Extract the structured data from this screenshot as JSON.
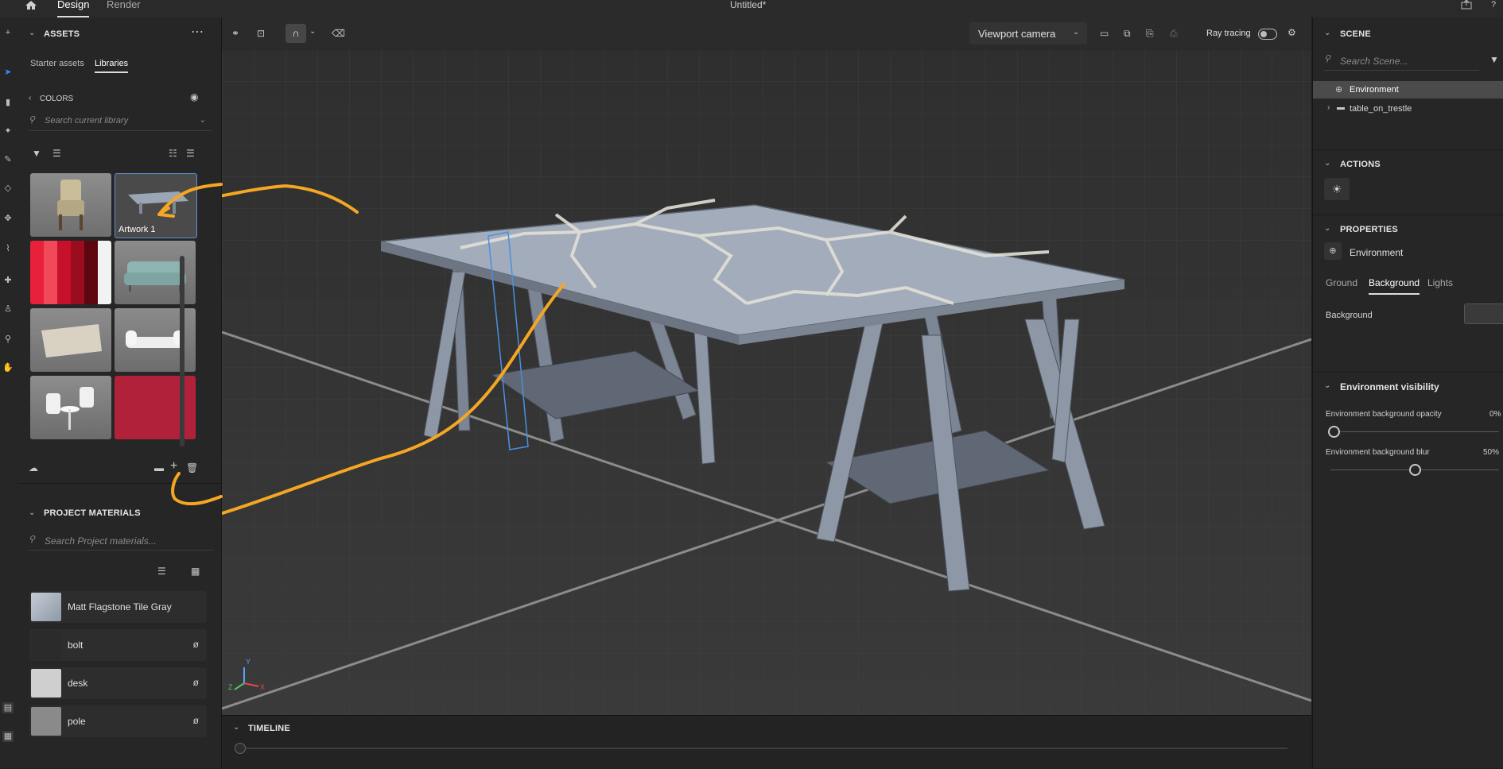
{
  "topbar": {
    "tabs": [
      "Design",
      "Render"
    ],
    "document_title": "Untitled*"
  },
  "assets": {
    "title": "ASSETS",
    "subtabs": [
      "Starter assets",
      "Libraries"
    ],
    "active_subtab": "Libraries",
    "library_back_label": "COLORS",
    "search_placeholder": "Search current library",
    "thumbs": [
      {
        "name": "armchair-thumb",
        "label": ""
      },
      {
        "name": "artwork-thumb",
        "label": "Artwork 1"
      },
      {
        "name": "red-palette-thumb",
        "label": ""
      },
      {
        "name": "sofa-thumb",
        "label": ""
      },
      {
        "name": "pouch-thumb",
        "label": ""
      },
      {
        "name": "daybed-thumb",
        "label": ""
      },
      {
        "name": "chairs-table-thumb",
        "label": ""
      },
      {
        "name": "red-swatch-thumb",
        "label": ""
      }
    ]
  },
  "project_materials": {
    "title": "PROJECT MATERIALS",
    "search_placeholder": "Search Project materials...",
    "items": [
      {
        "name": "Matt Flagstone Tile Gray",
        "swatch": "#a9b2bf",
        "has_null_icon": false
      },
      {
        "name": "bolt",
        "swatch": "#2b2b2b",
        "has_null_icon": true
      },
      {
        "name": "desk",
        "swatch": "#cfcfcf",
        "has_null_icon": true
      },
      {
        "name": "pole",
        "swatch": "#8a8a8a",
        "has_null_icon": true
      }
    ],
    "null_glyph": "ø"
  },
  "viewport": {
    "camera_label": "Viewport camera",
    "ray_tracing_label": "Ray tracing",
    "ray_tracing_on": false,
    "axis_labels": {
      "x": "X",
      "y": "Y",
      "z": "Z"
    }
  },
  "timeline": {
    "title": "TIMELINE"
  },
  "scene": {
    "title": "SCENE",
    "search_placeholder": "Search Scene...",
    "tree": [
      {
        "label": "Environment",
        "selected": true
      },
      {
        "label": "table_on_trestle",
        "selected": false
      }
    ]
  },
  "actions": {
    "title": "ACTIONS"
  },
  "properties": {
    "title": "PROPERTIES",
    "object_label": "Environment",
    "tabs": [
      "Ground",
      "Background",
      "Lights"
    ],
    "active_tab": "Background",
    "background_label": "Background",
    "env_visibility_title": "Environment visibility",
    "opacity_label": "Environment background opacity",
    "opacity_value": "0%",
    "opacity_fraction": 0,
    "blur_label": "Environment background blur",
    "blur_value": "50%",
    "blur_fraction": 0.5
  },
  "colors": {
    "accent": "#f5a623",
    "panel": "#262626",
    "selection": "#4b4b4b"
  }
}
